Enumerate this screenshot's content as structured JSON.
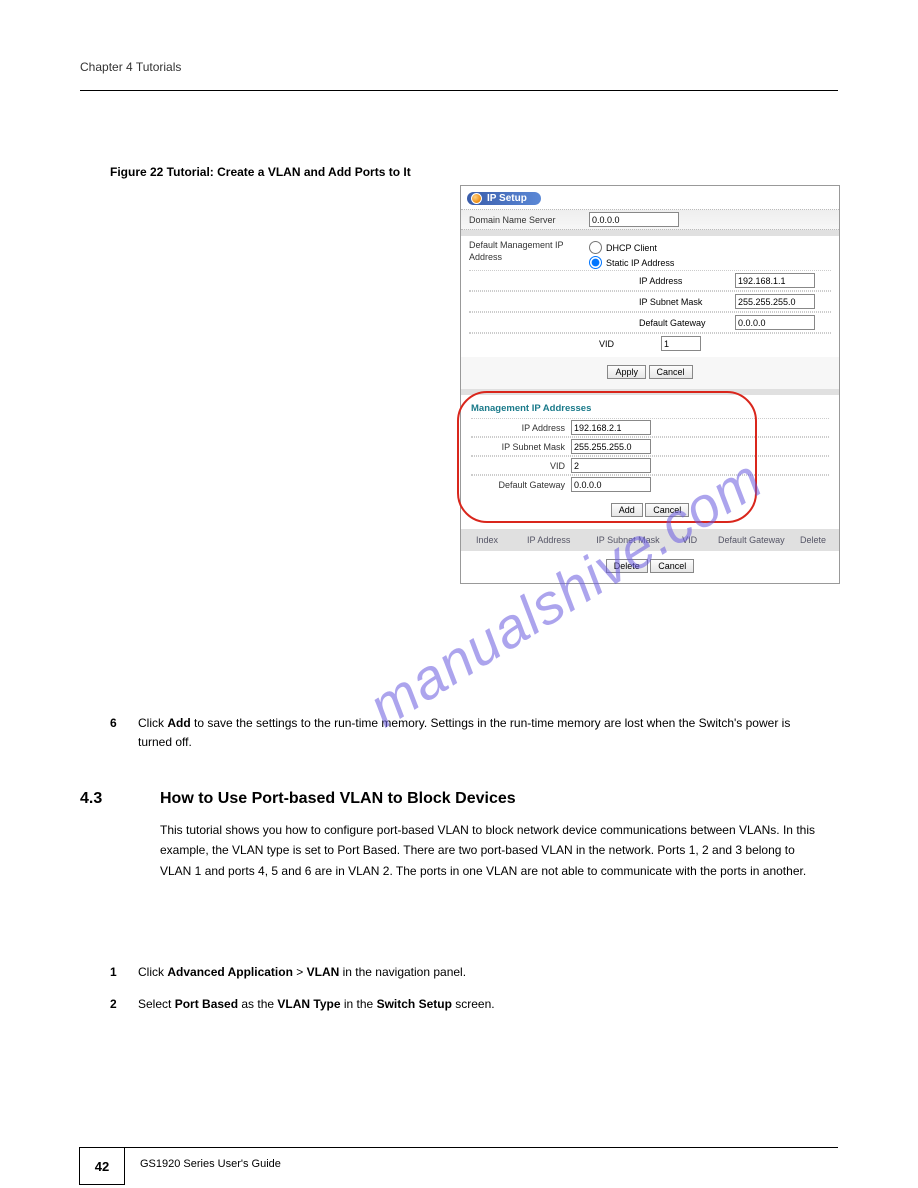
{
  "header": {
    "left": "Chapter 4 Tutorials"
  },
  "figure": {
    "caption": "Figure 22   Tutorial: Create a VLAN and Add Ports to It"
  },
  "panel": {
    "title": "IP Setup",
    "dns_label": "Domain Name Server",
    "dns_value": "0.0.0.0",
    "default_mgmt_label": "Default Management IP Address",
    "radio_dhcp": "DHCP Client",
    "radio_static": "Static IP Address",
    "ip_addr_label": "IP Address",
    "ip_addr_value": "192.168.1.1",
    "subnet_label": "IP Subnet Mask",
    "subnet_value": "255.255.255.0",
    "gateway_label": "Default Gateway",
    "gateway_value": "0.0.0.0",
    "vid_label": "VID",
    "vid_value": "1",
    "apply_btn": "Apply",
    "cancel_btn": "Cancel",
    "mgmt_title": "Management IP Addresses",
    "mgmt_ip_label": "IP Address",
    "mgmt_ip_value": "192.168.2.1",
    "mgmt_subnet_label": "IP Subnet Mask",
    "mgmt_subnet_value": "255.255.255.0",
    "mgmt_vid_label": "VID",
    "mgmt_vid_value": "2",
    "mgmt_gw_label": "Default Gateway",
    "mgmt_gw_value": "0.0.0.0",
    "add_btn": "Add",
    "table": {
      "index": "Index",
      "ip": "IP Address",
      "subnet": "IP Subnet Mask",
      "vid": "VID",
      "gateway": "Default Gateway",
      "delete": "Delete"
    },
    "delete_btn": "Delete"
  },
  "body": {
    "step6_num": "6",
    "step6_text_a": "Click ",
    "step6_bold": "Add",
    "step6_text_b": " to save the settings to the run-time memory. Settings in the run-time memory are lost when the Switch's power is turned off."
  },
  "section": {
    "number": "4.3",
    "title": "How to Use Port-based VLAN to Block Devices",
    "body": "This tutorial shows you how to configure port-based VLAN to block network device communications between VLANs. In this example, the VLAN type is set to Port Based. There are two port-based VLAN in the network. Ports 1, 2 and 3 belong to VLAN 1 and ports 4, 5 and 6 are in VLAN 2. The ports in one VLAN are not able to communicate with the ports in another."
  },
  "port_steps": {
    "step1_num": "1",
    "step1_a": "Click ",
    "step1_b1": "Advanced Application",
    "step1_sep": " > ",
    "step1_b2": "VLAN",
    "step1_c": " in the navigation panel.",
    "step2_num": "2",
    "step2_a": "Select ",
    "step2_b1": "Port Based",
    "step2_mid": " as the ",
    "step2_b2": "VLAN Type",
    "step2_end": " in the ",
    "step2_b3": "Switch Setup",
    "step2_tail": " screen."
  },
  "footer": {
    "page": "42",
    "text": "GS1920 Series User's Guide"
  },
  "watermark": "manualshive.com"
}
